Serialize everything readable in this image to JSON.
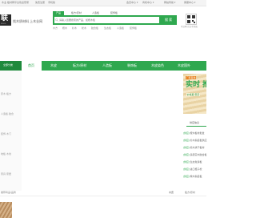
{
  "colors": {
    "brand_green": "#2fa84f",
    "dark_green": "#1f8a3c",
    "orange": "#e8821f",
    "light_gray": "#f4f4f4"
  },
  "topbar": {
    "left_links": [
      "木业·板材网平台",
      "欢迎登录",
      "免费注册",
      "手机版"
    ],
    "right_links": [
      "会员中心 ▾",
      "商机中心 ▾",
      "网站导航 ▾",
      "客服中心 ▾"
    ]
  },
  "header": {
    "logo_text": "联",
    "logo_sub": "WOOD",
    "slogan": "找木质材料 上木业网",
    "search_tabs": [
      "产品",
      "板方/原材",
      "人造板",
      "装饰板"
    ],
    "active_tab_index": 0,
    "search_placeholder": "请输入您要搜索的产品、如桉木板",
    "search_button": "搜 索",
    "hot_keywords": [
      "木方",
      "桉木",
      "杉木",
      "松木",
      "胶合板",
      "生态板",
      "人造板",
      "装饰板"
    ],
    "right_promo": "木业网 官方手机端"
  },
  "nav": {
    "category_label": "全部分类",
    "items": [
      "首页",
      "木皮",
      "板方/原材",
      "人造板",
      "装饰板",
      "木皮染色",
      "木皮国外"
    ],
    "active_index": 0
  },
  "left_sidebar": {
    "lines": [
      "原木·板方",
      "人造板·胶合",
      "装饰·木门",
      "地板·木线",
      "家具·家居"
    ]
  },
  "banner": {
    "tag": "厂家直供",
    "headline": "实时 推",
    "sub": "价格更 稳定"
  },
  "right_panel": {
    "tab_label": "供应信息",
    "items": [
      {
        "tag": "[供应]",
        "text": "桉木板材批发"
      },
      {
        "tag": "[供应]",
        "text": "杉木指接板供应"
      },
      {
        "tag": "[供应]",
        "text": "松木烘干板材"
      },
      {
        "tag": "[供应]",
        "text": "多层实木胶合板"
      },
      {
        "tag": "[供应]",
        "text": "生态免漆板"
      },
      {
        "tag": "[供应]",
        "text": "进口樟子松"
      },
      {
        "tag": "[供应]",
        "text": "橡木指接板"
      }
    ]
  },
  "section": {
    "title": "推荐商品/品牌",
    "tabs": [
      "木皮",
      "板方/原材"
    ]
  }
}
